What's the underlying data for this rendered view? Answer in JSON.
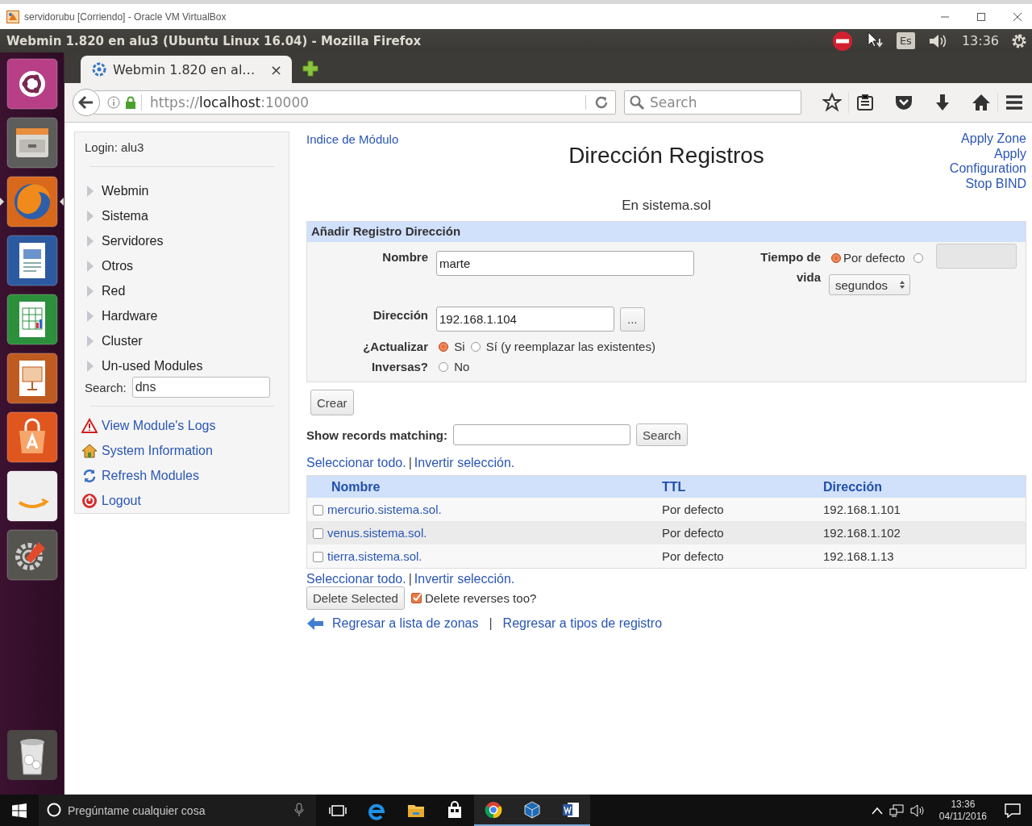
{
  "vm_window": {
    "title": "servidorubu [Corriendo] - Oracle VM VirtualBox"
  },
  "top_panel": {
    "window_title": "Webmin 1.820 en alu3 (Ubuntu Linux 16.04) - Mozilla Firefox",
    "keyboard_layout": "Es",
    "clock": "13:36"
  },
  "launcher": {
    "items": [
      {
        "focused": false
      },
      {
        "focused": false
      },
      {
        "focused": true
      },
      {
        "focused": false
      },
      {
        "focused": false
      },
      {
        "focused": false
      },
      {
        "focused": false
      },
      {
        "focused": false
      },
      {
        "focused": false
      }
    ]
  },
  "browser": {
    "tabs": [
      {
        "title": "Webmin 1.820 en al…",
        "close": "×",
        "selected": true
      }
    ],
    "url": {
      "scheme": "https://",
      "host": "localhost",
      "port": ":10000"
    },
    "search": {
      "placeholder": "Search"
    }
  },
  "sidebar": {
    "login": "Login: alu3",
    "categories": [
      {
        "label": "Webmin",
        "expanded": false
      },
      {
        "label": "Sistema",
        "expanded": false
      },
      {
        "label": "Servidores",
        "expanded": false
      },
      {
        "label": "Otros",
        "expanded": false
      },
      {
        "label": "Red",
        "expanded": false
      },
      {
        "label": "Hardware",
        "expanded": false
      },
      {
        "label": "Cluster",
        "expanded": false
      },
      {
        "label": "Un-used Modules",
        "expanded": false
      }
    ],
    "search": {
      "label": "Search:",
      "value": "dns"
    },
    "links": [
      {
        "label": "View Module's Logs"
      },
      {
        "label": "System Information"
      },
      {
        "label": "Refresh Modules"
      },
      {
        "label": "Logout"
      }
    ]
  },
  "main": {
    "module_index": "Indice de Módulo",
    "title": "Dirección Registros",
    "subtitle": "En sistema.sol",
    "actions": [
      "Apply Zone",
      "Apply Configuration",
      "Stop BIND"
    ],
    "form": {
      "title": "Añadir Registro Dirección",
      "name": {
        "label": "Nombre",
        "value": "marte"
      },
      "ttl": {
        "label": "Tiempo de vida",
        "options": [
          {
            "label": "Por defecto",
            "selected": true
          },
          {
            "selected": false
          }
        ],
        "unit": "segundos"
      },
      "address": {
        "label": "Dirección",
        "value": "192.168.1.104",
        "picker": "..."
      },
      "reverse": {
        "label": "¿Actualizar Inversas?",
        "options": [
          {
            "label": "Si",
            "selected": true
          },
          {
            "label": "Sí (y reemplazar las existentes)",
            "selected": false
          },
          {
            "label": "No",
            "selected": false
          }
        ]
      }
    },
    "create_button": "Crear",
    "filter": {
      "label": "Show records matching:",
      "button": "Search"
    },
    "select_links_top": [
      "Seleccionar todo.",
      "|",
      "Invertir selección."
    ],
    "table": {
      "columns": [
        "Nombre",
        "TTL",
        "Dirección"
      ],
      "rows": [
        {
          "checked": false,
          "name": "mercurio.sistema.sol.",
          "ttl": "Por defecto",
          "address": "192.168.1.101"
        },
        {
          "checked": false,
          "name": "venus.sistema.sol.",
          "ttl": "Por defecto",
          "address": "192.168.1.102"
        },
        {
          "checked": false,
          "name": "tierra.sistema.sol.",
          "ttl": "Por defecto",
          "address": "192.168.1.13"
        }
      ]
    },
    "select_links_bottom": [
      "Seleccionar todo.",
      "|",
      "Invertir selección."
    ],
    "delete_button": "Delete Selected",
    "delete_reverses": {
      "label": "Delete reverses too?",
      "checked": true
    },
    "back_links": [
      "Regresar a lista de zonas",
      "|",
      "Regresar a tipos de registro"
    ]
  },
  "taskbar": {
    "search_placeholder": "Pregúntame cualquier cosa",
    "apps": [
      {
        "running": false
      },
      {
        "running": false
      },
      {
        "running": false
      },
      {
        "running": true
      },
      {
        "running": true
      },
      {
        "running": true
      }
    ],
    "time": "13:36",
    "date": "04/11/2016"
  }
}
